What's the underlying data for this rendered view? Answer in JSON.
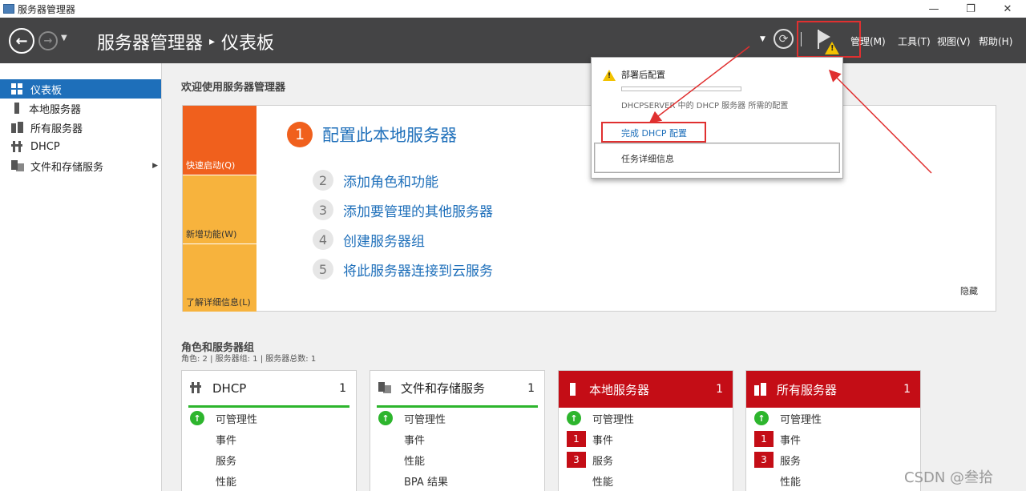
{
  "window": {
    "title": "服务器管理器",
    "controls": [
      "—",
      "❐",
      "✕"
    ]
  },
  "header": {
    "breadcrumb_root": "服务器管理器",
    "breadcrumb_sep": "▸",
    "breadcrumb_current": "仪表板",
    "menus": [
      "管理(M)",
      "工具(T)",
      "视图(V)",
      "帮助(H)"
    ]
  },
  "sidebar": {
    "items": [
      {
        "label": "仪表板",
        "icon": "dashboard-icon",
        "active": true
      },
      {
        "label": "本地服务器",
        "icon": "server-icon"
      },
      {
        "label": "所有服务器",
        "icon": "servers-icon"
      },
      {
        "label": "DHCP",
        "icon": "dhcp-icon"
      },
      {
        "label": "文件和存储服务",
        "icon": "file-storage-icon",
        "arrow": "▶"
      }
    ]
  },
  "welcome": {
    "title": "欢迎使用服务器管理器",
    "tabs": [
      "快速启动(Q)",
      "新增功能(W)",
      "了解详细信息(L)"
    ],
    "steps": [
      {
        "num": "1",
        "label": "配置此本地服务器"
      },
      {
        "num": "2",
        "label": "添加角色和功能"
      },
      {
        "num": "3",
        "label": "添加要管理的其他服务器"
      },
      {
        "num": "4",
        "label": "创建服务器组"
      },
      {
        "num": "5",
        "label": "将此服务器连接到云服务"
      }
    ],
    "hide": "隐藏"
  },
  "roles": {
    "title": "角色和服务器组",
    "subtitle": "角色: 2 | 服务器组: 1 | 服务器总数: 1",
    "tiles": [
      {
        "name": "DHCP",
        "count": "1",
        "status": "green",
        "rows": [
          "可管理性",
          "事件",
          "服务",
          "性能"
        ]
      },
      {
        "name": "文件和存储服务",
        "count": "1",
        "status": "green",
        "rows": [
          "可管理性",
          "事件",
          "性能",
          "BPA 结果"
        ]
      },
      {
        "name": "本地服务器",
        "count": "1",
        "status": "red",
        "rows": [
          "可管理性",
          "事件",
          "服务",
          "性能"
        ],
        "badges": [
          "",
          "1",
          "3",
          ""
        ]
      },
      {
        "name": "所有服务器",
        "count": "1",
        "status": "red",
        "rows": [
          "可管理性",
          "事件",
          "服务",
          "性能"
        ],
        "badges": [
          "",
          "1",
          "3",
          ""
        ]
      }
    ]
  },
  "notification": {
    "title": "部署后配置",
    "description": "DHCPSERVER 中的 DHCP 服务器 所需的配置",
    "action": "完成 DHCP 配置",
    "task_details": "任务详细信息"
  },
  "watermark": "CSDN @叁拾",
  "colors": {
    "header_bg": "#444445",
    "accent_blue": "#1e6fba",
    "quickstart_orange": "#f0601d",
    "tab_yellow": "#f7b33d",
    "status_red": "#c40d16",
    "status_green": "#2db52d",
    "annotation_red": "#e03030"
  }
}
